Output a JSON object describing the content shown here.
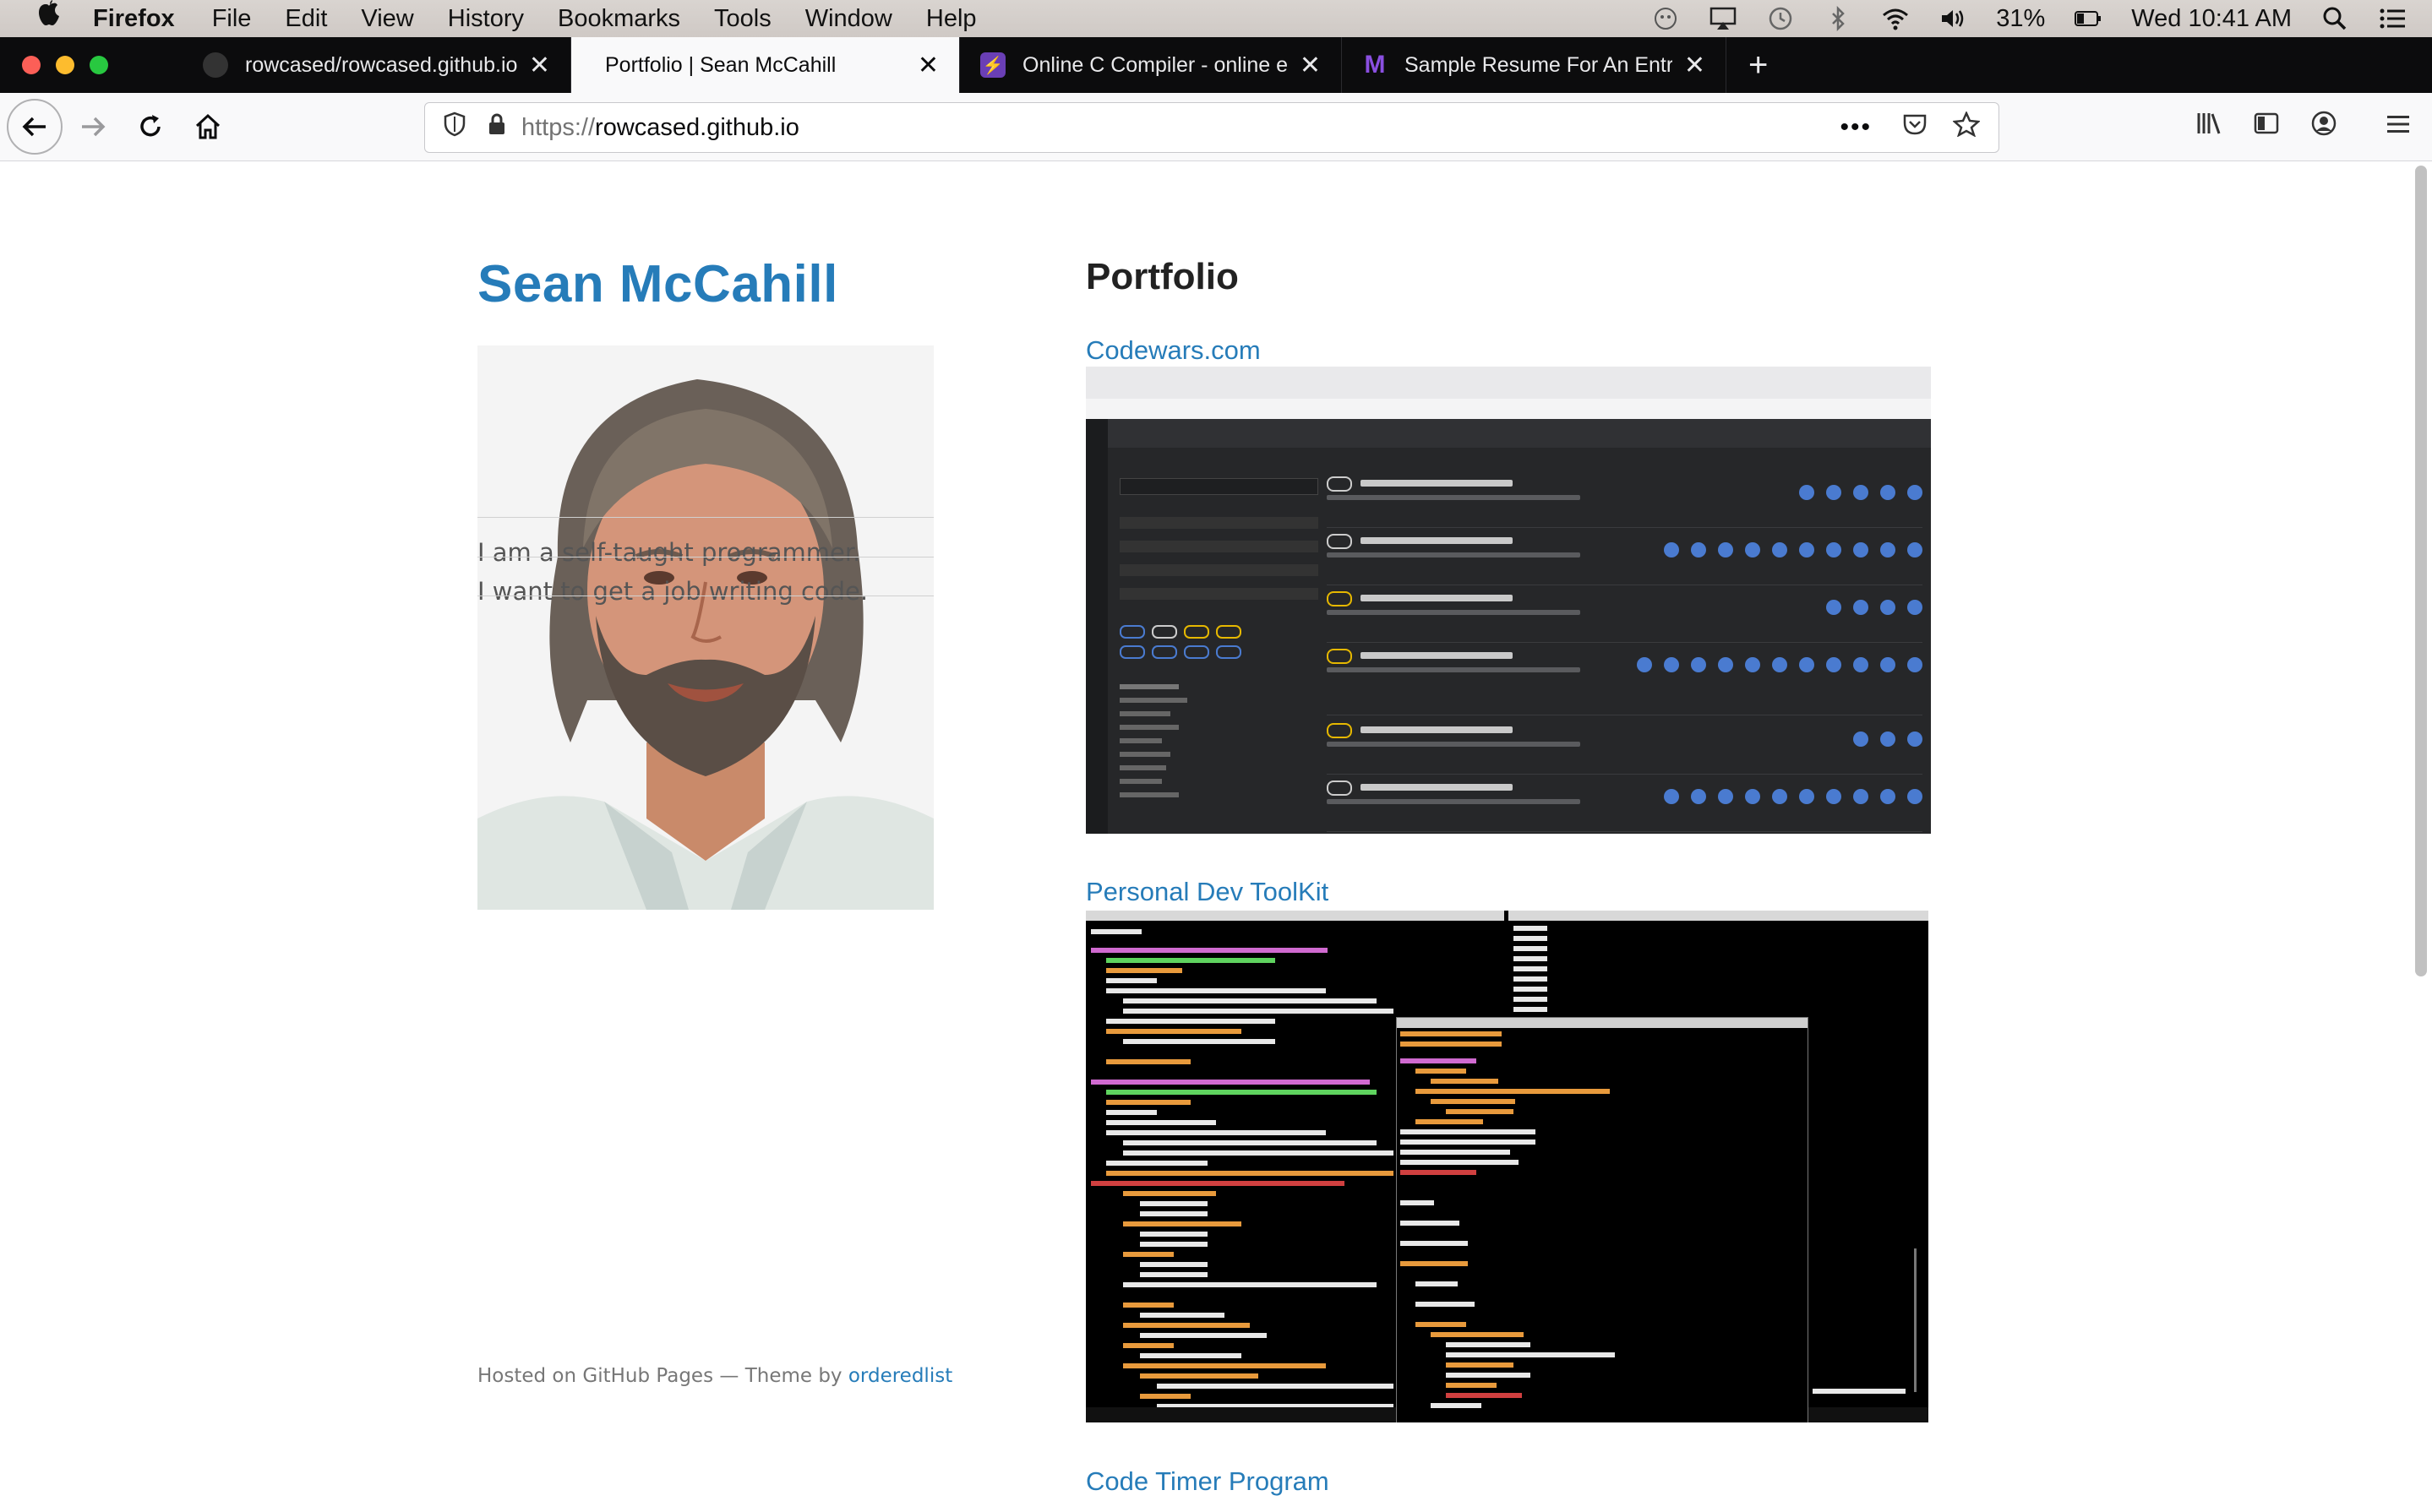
{
  "menubar": {
    "app_name": "Firefox",
    "menus": [
      "File",
      "Edit",
      "View",
      "History",
      "Bookmarks",
      "Tools",
      "Window",
      "Help"
    ],
    "battery": "31%",
    "clock": "Wed 10:41 AM"
  },
  "tabs": [
    {
      "title": "rowcased/rowcased.github.io: ",
      "favicon": "github-icon",
      "active": false
    },
    {
      "title": "Portfolio | Sean McCahill",
      "favicon": "none",
      "active": true
    },
    {
      "title": "Online C Compiler - online edi",
      "favicon": "lightning-icon",
      "active": false
    },
    {
      "title": "Sample Resume For An Entry-L",
      "favicon": "m-logo-icon",
      "active": false
    }
  ],
  "url": {
    "scheme": "https://",
    "host": "rowcased.github.io"
  },
  "site": {
    "name": "Sean McCahill",
    "bio_1": "I am a self-taught programmer.",
    "bio_2": "I want to get a job writing code.",
    "footer_prefix": "Hosted on GitHub Pages — Theme by ",
    "footer_link": "orderedlist"
  },
  "portfolio": {
    "heading": "Portfolio",
    "items": [
      {
        "label": "Codewars.com"
      },
      {
        "label": "Personal Dev ToolKit"
      },
      {
        "label": "Code Timer Program"
      }
    ]
  },
  "colors": {
    "link": "#267CB9",
    "tabstrip": "#0c0c0d",
    "toolbar": "#f9f9fa"
  }
}
